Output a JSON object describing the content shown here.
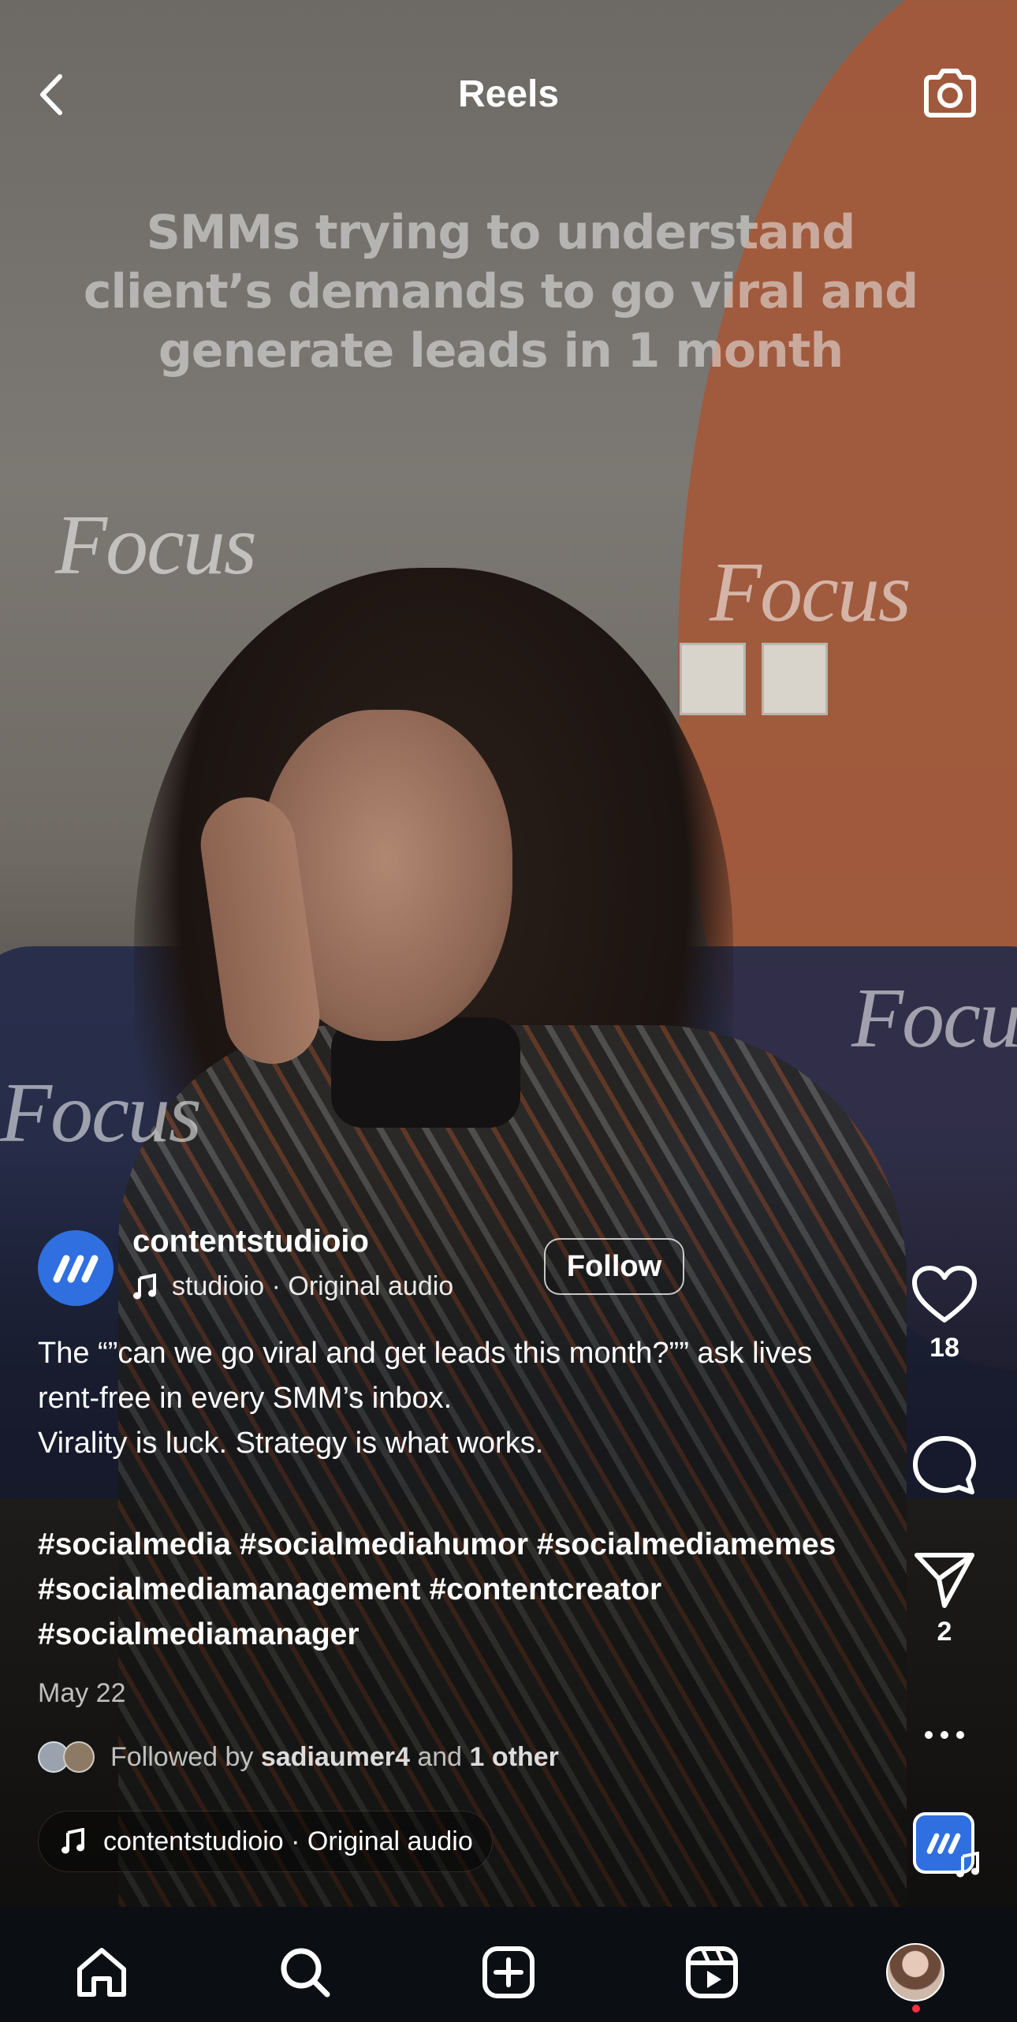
{
  "header": {
    "title": "Reels"
  },
  "video": {
    "overlay_text": "SMMs trying to understand client’s demands to go viral and generate leads in 1 month",
    "watermark": "Focus"
  },
  "post": {
    "username": "contentstudioio",
    "audio_line": "studioio · Original audio",
    "follow_label": "Follow",
    "caption_lines": [
      "The “”can we go viral and get leads this month?”” ask lives rent-free in every SMM’s inbox.",
      "Virality is luck. Strategy is what works."
    ],
    "hashtags": "#socialmedia #socialmediahumor #socialmediamemes #socialmediamanagement #contentcreator #socialmediamanager",
    "date": "May 22",
    "followed_by": {
      "prefix": "Followed by",
      "user": "sadiaumer4",
      "and": "and",
      "other": "1 other"
    },
    "audio_pill": "contentstudioio · Original audio"
  },
  "actions": {
    "likes": "18",
    "shares": "2"
  },
  "icons": [
    "back-icon",
    "camera-icon",
    "music-note-icon",
    "heart-icon",
    "comment-icon",
    "send-icon",
    "more-icon",
    "home-icon",
    "search-icon",
    "create-icon",
    "reels-icon"
  ],
  "colors": {
    "brand_blue": "#2f6fe0",
    "nav_bg": "#0b0e13",
    "notification": "#ff3040"
  }
}
